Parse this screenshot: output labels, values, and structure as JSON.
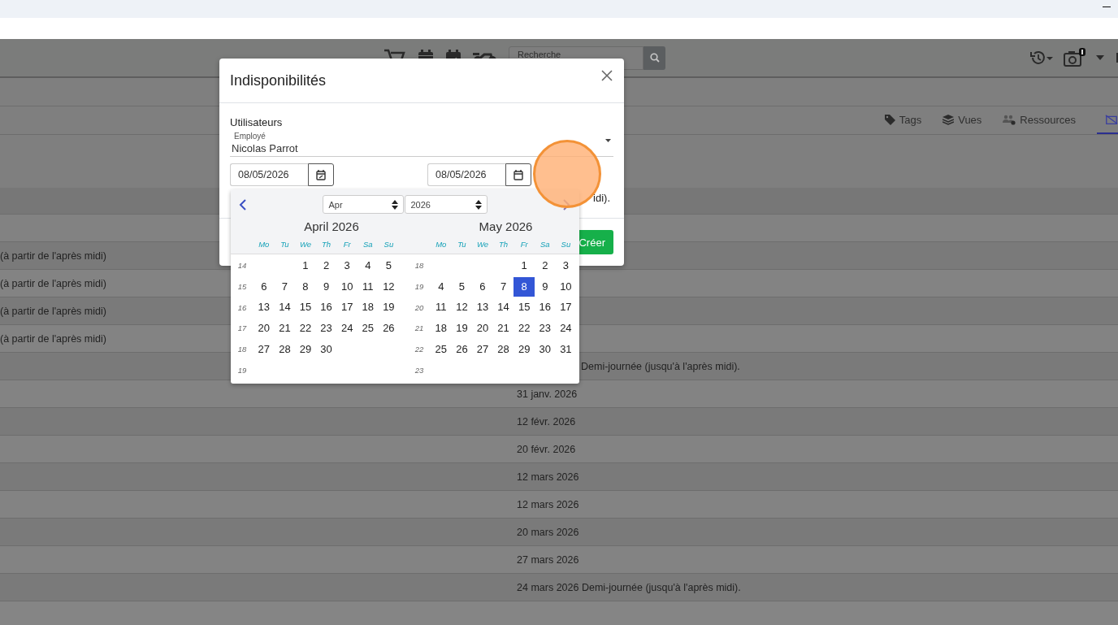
{
  "navbar": {
    "search": {
      "placeholder": "Recherche"
    }
  },
  "tabs": [
    {
      "kind": "text",
      "label": "Tags",
      "selected": false
    },
    {
      "kind": "text",
      "label": "Vues",
      "selected": false
    },
    {
      "kind": "text",
      "label": "Ressources",
      "selected": false
    },
    {
      "kind": "icon",
      "selected": true
    }
  ],
  "table": {
    "rows": [
      {
        "column_1": "(à partir de l'après midi)"
      },
      {
        "column_1": "(à partir de l'après midi)"
      },
      {
        "column_1": "(à partir de l'après midi)"
      },
      {
        "column_1": "(à partir de l'après midi)"
      },
      {
        "column_2": "Demi-journée (jusqu'à l'après midi).",
        "kind": "covered"
      },
      {
        "column_2": "31 janv. 2026"
      },
      {
        "column_2": "12 févr. 2026"
      },
      {
        "column_2": "20 févr. 2026"
      },
      {
        "column_2": "12 mars 2026"
      },
      {
        "column_2": "12 mars 2026"
      },
      {
        "column_2": "20 mars 2026"
      },
      {
        "column_2": "27 mars 2026"
      },
      {
        "column_2": "24 mars 2026 Demi-journée (jusqu'à l'après midi)."
      }
    ]
  },
  "modal": {
    "title": "Indisponibilités",
    "users_label": "Utilisateurs",
    "employee_field": {
      "label": "Employé",
      "value": "Nicolas Parrot"
    },
    "start_date": "08/05/2026",
    "end_date": "08/05/2026",
    "hint": "idi).",
    "submit": "Créer",
    "datepicker": {
      "month_select": "Apr",
      "year_select": "2026",
      "months": [
        {
          "title": "April 2026",
          "weekdays": [
            "Mo",
            "Tu",
            "We",
            "Th",
            "Fr",
            "Sa",
            "Su"
          ],
          "weeks": [
            {
              "number": "14",
              "days": [
                {
                  "kind": "blank"
                },
                {
                  "kind": "blank"
                },
                {
                  "kind": "day",
                  "day": "1",
                  "selected": false
                },
                {
                  "kind": "day",
                  "day": "2",
                  "selected": false
                },
                {
                  "kind": "day",
                  "day": "3",
                  "selected": false
                },
                {
                  "kind": "day",
                  "day": "4",
                  "selected": false
                },
                {
                  "kind": "day",
                  "day": "5",
                  "selected": false
                }
              ]
            },
            {
              "number": "15",
              "days": [
                {
                  "kind": "day",
                  "day": "6",
                  "selected": false
                },
                {
                  "kind": "day",
                  "day": "7",
                  "selected": false
                },
                {
                  "kind": "day",
                  "day": "8",
                  "selected": false
                },
                {
                  "kind": "day",
                  "day": "9",
                  "selected": false
                },
                {
                  "kind": "day",
                  "day": "10",
                  "selected": false
                },
                {
                  "kind": "day",
                  "day": "11",
                  "selected": false
                },
                {
                  "kind": "day",
                  "day": "12",
                  "selected": false
                }
              ]
            },
            {
              "number": "16",
              "days": [
                {
                  "kind": "day",
                  "day": "13",
                  "selected": false
                },
                {
                  "kind": "day",
                  "day": "14",
                  "selected": false
                },
                {
                  "kind": "day",
                  "day": "15",
                  "selected": false
                },
                {
                  "kind": "day",
                  "day": "16",
                  "selected": false
                },
                {
                  "kind": "day",
                  "day": "17",
                  "selected": false
                },
                {
                  "kind": "day",
                  "day": "18",
                  "selected": false
                },
                {
                  "kind": "day",
                  "day": "19",
                  "selected": false
                }
              ]
            },
            {
              "number": "17",
              "days": [
                {
                  "kind": "day",
                  "day": "20",
                  "selected": false
                },
                {
                  "kind": "day",
                  "day": "21",
                  "selected": false
                },
                {
                  "kind": "day",
                  "day": "22",
                  "selected": false
                },
                {
                  "kind": "day",
                  "day": "23",
                  "selected": false
                },
                {
                  "kind": "day",
                  "day": "24",
                  "selected": false
                },
                {
                  "kind": "day",
                  "day": "25",
                  "selected": false
                },
                {
                  "kind": "day",
                  "day": "26",
                  "selected": false
                }
              ]
            },
            {
              "number": "18",
              "days": [
                {
                  "kind": "day",
                  "day": "27",
                  "selected": false
                },
                {
                  "kind": "day",
                  "day": "28",
                  "selected": false
                },
                {
                  "kind": "day",
                  "day": "29",
                  "selected": false
                },
                {
                  "kind": "day",
                  "day": "30",
                  "selected": false
                }
              ]
            },
            {
              "number": "19"
            }
          ]
        },
        {
          "title": "May 2026",
          "weekdays": [
            "Mo",
            "Tu",
            "We",
            "Th",
            "Fr",
            "Sa",
            "Su"
          ],
          "weeks": [
            {
              "number": "18",
              "days": [
                {
                  "kind": "blank"
                },
                {
                  "kind": "blank"
                },
                {
                  "kind": "blank"
                },
                {
                  "kind": "blank"
                },
                {
                  "kind": "day",
                  "day": "1",
                  "selected": false
                },
                {
                  "kind": "day",
                  "day": "2",
                  "selected": false
                },
                {
                  "kind": "day",
                  "day": "3",
                  "selected": false
                }
              ]
            },
            {
              "number": "19",
              "days": [
                {
                  "kind": "day",
                  "day": "4",
                  "selected": false
                },
                {
                  "kind": "day",
                  "day": "5",
                  "selected": false
                },
                {
                  "kind": "day",
                  "day": "6",
                  "selected": false
                },
                {
                  "kind": "day",
                  "day": "7",
                  "selected": false
                },
                {
                  "kind": "day",
                  "day": "8",
                  "selected": true
                },
                {
                  "kind": "day",
                  "day": "9",
                  "selected": false
                },
                {
                  "kind": "day",
                  "day": "10",
                  "selected": false
                }
              ]
            },
            {
              "number": "20",
              "days": [
                {
                  "kind": "day",
                  "day": "11",
                  "selected": false
                },
                {
                  "kind": "day",
                  "day": "12",
                  "selected": false
                },
                {
                  "kind": "day",
                  "day": "13",
                  "selected": false
                },
                {
                  "kind": "day",
                  "day": "14",
                  "selected": false
                },
                {
                  "kind": "day",
                  "day": "15",
                  "selected": false
                },
                {
                  "kind": "day",
                  "day": "16",
                  "selected": false
                },
                {
                  "kind": "day",
                  "day": "17",
                  "selected": false
                }
              ]
            },
            {
              "number": "21",
              "days": [
                {
                  "kind": "day",
                  "day": "18",
                  "selected": false
                },
                {
                  "kind": "day",
                  "day": "19",
                  "selected": false
                },
                {
                  "kind": "day",
                  "day": "20",
                  "selected": false
                },
                {
                  "kind": "day",
                  "day": "21",
                  "selected": false
                },
                {
                  "kind": "day",
                  "day": "22",
                  "selected": false
                },
                {
                  "kind": "day",
                  "day": "23",
                  "selected": false
                },
                {
                  "kind": "day",
                  "day": "24",
                  "selected": false
                }
              ]
            },
            {
              "number": "22",
              "days": [
                {
                  "kind": "day",
                  "day": "25",
                  "selected": false
                },
                {
                  "kind": "day",
                  "day": "26",
                  "selected": false
                },
                {
                  "kind": "day",
                  "day": "27",
                  "selected": false
                },
                {
                  "kind": "day",
                  "day": "28",
                  "selected": false
                },
                {
                  "kind": "day",
                  "day": "29",
                  "selected": false
                },
                {
                  "kind": "day",
                  "day": "30",
                  "selected": false
                },
                {
                  "kind": "day",
                  "day": "31",
                  "selected": false
                }
              ]
            },
            {
              "number": "23"
            }
          ]
        }
      ]
    }
  }
}
